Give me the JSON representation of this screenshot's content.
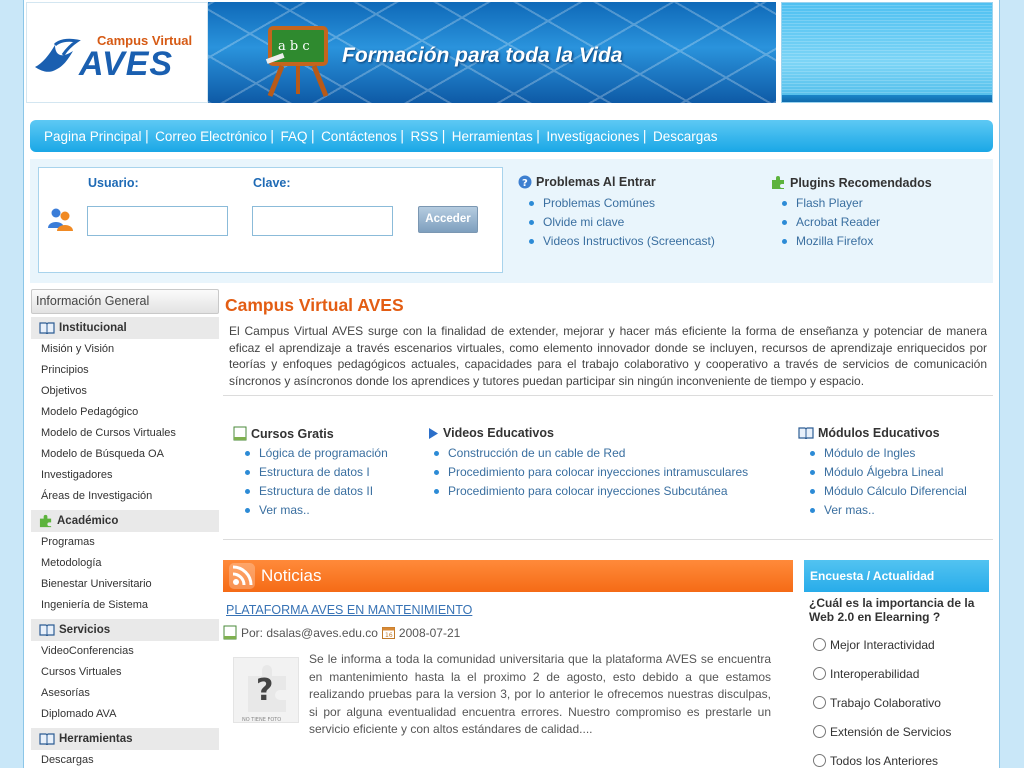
{
  "header": {
    "logo_campus": "Campus Virtual",
    "logo_aves": "AVES",
    "slogan": "Formación para toda la Vida",
    "board_letters": "a b c"
  },
  "nav": {
    "items": [
      {
        "label": "Pagina Principal"
      },
      {
        "label": "Correo Electrónico"
      },
      {
        "label": "FAQ"
      },
      {
        "label": "Contáctenos"
      },
      {
        "label": "RSS"
      },
      {
        "label": "Herramientas"
      },
      {
        "label": "Investigaciones"
      },
      {
        "label": "Descargas"
      }
    ],
    "separator": "|"
  },
  "login": {
    "user_label": "Usuario:",
    "user_value": "",
    "pass_label": "Clave:",
    "pass_value": "",
    "submit_label": "Acceder"
  },
  "problems": {
    "title": "Problemas Al Entrar",
    "items": [
      "Problemas Comúnes",
      "Olvide mi clave",
      "Videos Instructivos (Screencast)"
    ]
  },
  "plugins": {
    "title": "Plugins Recomendados",
    "items": [
      "Flash Player",
      "Acrobat Reader",
      "Mozilla Firefox"
    ]
  },
  "sidebar": {
    "header": "Información General",
    "sections": [
      {
        "title": "Institucional",
        "items": [
          "Misión y Visión",
          "Principios",
          "Objetivos",
          "Modelo Pedagógico",
          "Modelo de Cursos Virtuales",
          "Modelo de Búsqueda OA",
          "Investigadores",
          "Áreas de Investigación"
        ]
      },
      {
        "title": "Académico",
        "items": [
          "Programas",
          "Metodología",
          "Bienestar Universitario",
          "Ingeniería de Sistema"
        ]
      },
      {
        "title": "Servicios",
        "items": [
          "VideoConferencias",
          "Cursos Virtuales",
          "Asesorías",
          "Diplomado AVA"
        ]
      },
      {
        "title": "Herramientas",
        "items": [
          "Descargas"
        ]
      }
    ]
  },
  "main": {
    "title": "Campus Virtual AVES",
    "intro": "El Campus Virtual AVES surge con la finalidad de extender, mejorar y hacer más eficiente la forma de enseñanza y potenciar de manera eficaz el aprendizaje a través escenarios virtuales, como elemento innovador donde se incluyen, recursos de aprendizaje enriquecidos por teorías y enfoques pedagógicos actuales, capacidades para el trabajo colaborativo y cooperativo a través de servicios de comunicación síncronos y asíncronos donde los aprendices y tutores puedan participar sin ningún inconveniente de tiempo y espacio.",
    "columns": [
      {
        "title": "Cursos Gratis",
        "items": [
          "Lógica de programación",
          "Estructura de datos I",
          "Estructura de datos II",
          "Ver mas.."
        ]
      },
      {
        "title": "Videos Educativos",
        "items": [
          "Construcción de un cable de Red",
          "Procedimiento para colocar inyecciones intramusculares",
          "Procedimiento para colocar inyecciones Subcutánea"
        ]
      },
      {
        "title": "Módulos Educativos",
        "items": [
          "Módulo de Ingles",
          "Módulo Álgebra Lineal",
          "Módulo Cálculo Diferencial",
          "Ver mas.."
        ]
      }
    ]
  },
  "news": {
    "section_title": "Noticias",
    "headline": "PLATAFORMA AVES EN MANTENIMIENTO",
    "author": "Por: dsalas@aves.edu.co",
    "date": "2008-07-21",
    "image_caption": "NO TIENE FOTO",
    "body": "Se le informa a toda la comunidad universitaria que la plataforma AVES se encuentra en mantenimiento hasta la el proximo 2 de agosto, esto debido a que estamos realizando pruebas para la version 3, por lo anterior le ofrecemos nuestras disculpas, si por alguna eventualidad encuentra errores. Nuestro compromiso es prestarle un servicio eficiente y con altos estándares de calidad...."
  },
  "poll": {
    "title": "Encuesta / Actualidad",
    "question": "¿Cuál es la importancia de la Web 2.0 en Elearning ?",
    "options": [
      "Mejor Interactividad",
      "Interoperabilidad",
      "Trabajo Colaborativo",
      "Extensión de Servicios",
      "Todos los Anteriores"
    ]
  },
  "colors": {
    "accent_blue": "#1aa7e6",
    "title_orange": "#e35d13",
    "news_orange": "#f56b16",
    "link_blue": "#3a6fa0"
  }
}
